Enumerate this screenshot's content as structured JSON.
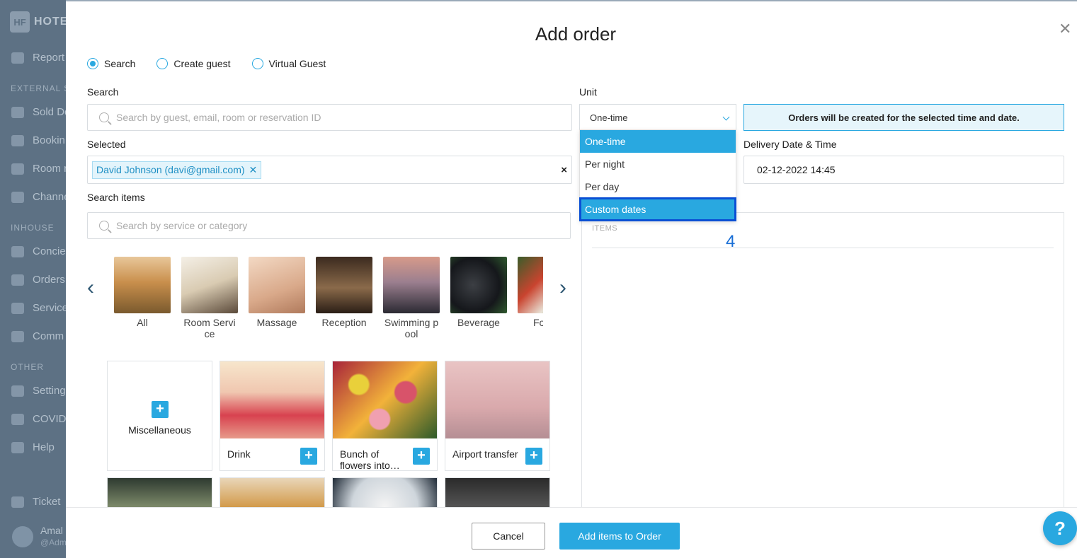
{
  "sidebar": {
    "logo_text": "HOTE",
    "logo_icon": "hf-logo-icon",
    "sections": [
      "EXTERNAL S",
      "INHOUSE",
      "OTHER"
    ],
    "items": [
      {
        "label": "Report",
        "icon": "report-icon"
      },
      {
        "label": "Sold De",
        "icon": "tag-icon"
      },
      {
        "label": "Bookin",
        "icon": "booking-icon"
      },
      {
        "label": "Room r",
        "icon": "chart-icon"
      },
      {
        "label": "Channe",
        "icon": "channel-icon"
      },
      {
        "label": "Concie",
        "icon": "phone-icon"
      },
      {
        "label": "Orders",
        "icon": "cart-icon"
      },
      {
        "label": "Service",
        "icon": "bell-icon"
      },
      {
        "label": "Comm",
        "icon": "chat-icon"
      },
      {
        "label": "Setting",
        "icon": "gear-icon"
      },
      {
        "label": "COVID",
        "icon": "virus-icon"
      },
      {
        "label": "Help",
        "icon": "help-icon"
      },
      {
        "label": "Ticket",
        "icon": "ticket-icon"
      }
    ],
    "user": {
      "name": "Amal",
      "role": "@Adm"
    }
  },
  "modal": {
    "title": "Add order",
    "modes": [
      {
        "label": "Search",
        "selected": true
      },
      {
        "label": "Create guest",
        "selected": false
      },
      {
        "label": "Virtual Guest",
        "selected": false
      }
    ],
    "search": {
      "label": "Search",
      "placeholder": "Search by guest, email, room or reservation ID"
    },
    "selected": {
      "label": "Selected",
      "tag": "David Johnson (davi@gmail.com)",
      "clear": "×"
    },
    "search_items": {
      "label": "Search items",
      "placeholder": "Search by service or category"
    },
    "categories": [
      "All",
      "Room Service",
      "Massage",
      "Reception",
      "Swimming pool",
      "Beverage",
      "Fo"
    ],
    "products": [
      {
        "title": "Miscellaneous"
      },
      {
        "title": "Drink"
      },
      {
        "title": "Bunch of flowers into…"
      },
      {
        "title": "Airport transfer"
      }
    ],
    "unit": {
      "label": "Unit",
      "value": "One-time",
      "options": [
        "One-time",
        "Per night",
        "Per day",
        "Custom dates"
      ]
    },
    "info_message": "Orders will be created for the selected time and date.",
    "delivery": {
      "label": "Delivery Date & Time",
      "value": "02-12-2022 14:45"
    },
    "items_panel": {
      "title": "ITEMS"
    },
    "step_marker": "4",
    "buttons": {
      "cancel": "Cancel",
      "add": "Add items to Order"
    },
    "help_fab": "?"
  },
  "colors": {
    "accent": "#29a8e0",
    "highlight_outline": "#0a4fd4",
    "sidebar": "#5d7184"
  }
}
